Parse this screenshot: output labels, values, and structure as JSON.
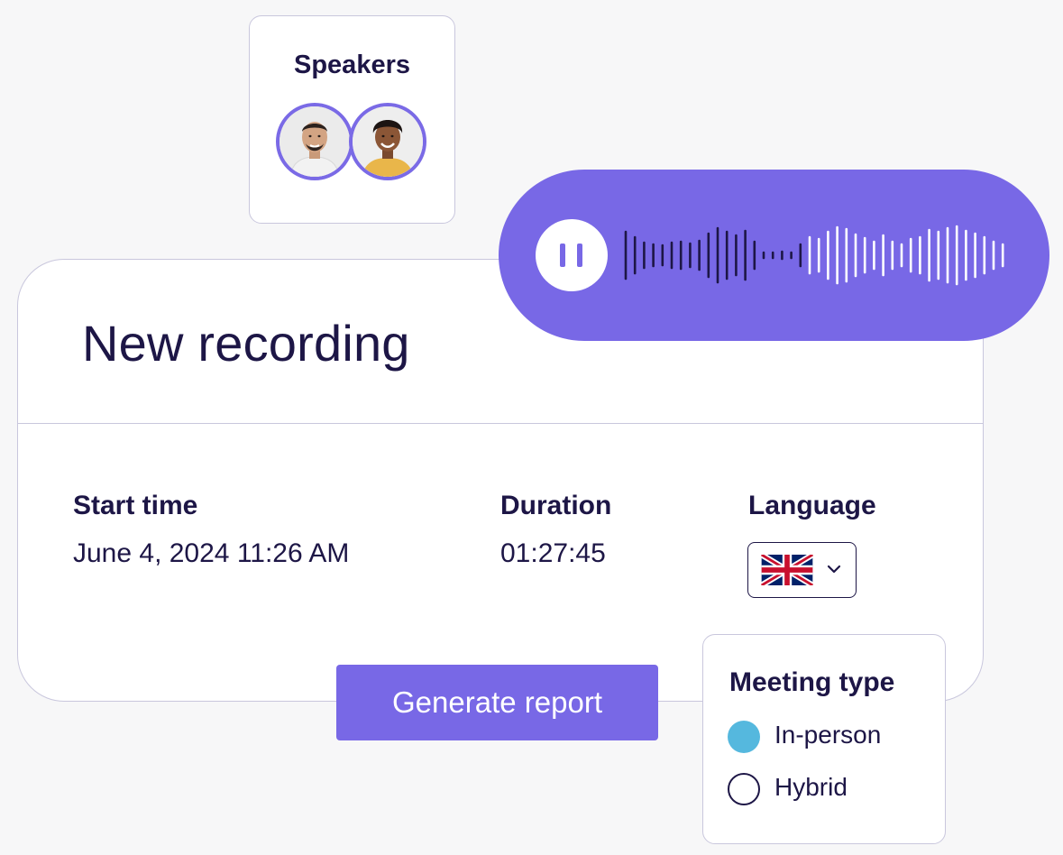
{
  "speakers": {
    "title": "Speakers",
    "avatars": [
      {
        "name": "speaker-1"
      },
      {
        "name": "speaker-2"
      }
    ]
  },
  "recording": {
    "title": "New recording",
    "state": "recording",
    "pause_icon": "pause-icon",
    "waveform_icon": "waveform-icon"
  },
  "details": {
    "start_time_label": "Start time",
    "start_time_value": "June 4, 2024 11:26 AM",
    "duration_label": "Duration",
    "duration_value": "01:27:45",
    "language_label": "Language",
    "language_selected_icon": "uk-flag-icon"
  },
  "actions": {
    "generate_report": "Generate report"
  },
  "meeting_type": {
    "title": "Meeting type",
    "options": [
      {
        "label": "In-person",
        "selected": true
      },
      {
        "label": "Hybrid",
        "selected": false
      }
    ]
  },
  "colors": {
    "accent": "#7868e6",
    "text": "#1d1646",
    "radio_selected": "#55b8de",
    "border": "#c9c7dd"
  }
}
